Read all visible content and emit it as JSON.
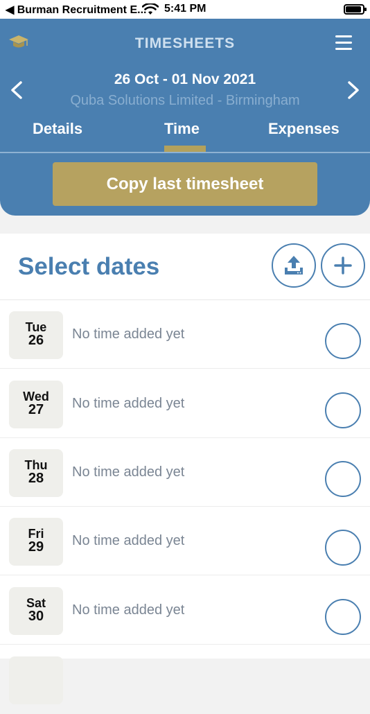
{
  "status_bar": {
    "back_label": "◀ Burman Recruitment E...",
    "time": "5:41 PM"
  },
  "header": {
    "title": "TIMESHEETS",
    "date_range": "26 Oct - 01 Nov 2021",
    "company": "Quba Solutions Limited - Birmingham",
    "tabs": [
      {
        "label": "Details"
      },
      {
        "label": "Time"
      },
      {
        "label": "Expenses"
      }
    ],
    "active_tab": "Time",
    "copy_button": "Copy last timesheet"
  },
  "select_dates": {
    "title": "Select dates",
    "days": [
      {
        "name": "Tue",
        "num": "26",
        "status": "No time added yet"
      },
      {
        "name": "Wed",
        "num": "27",
        "status": "No time added yet"
      },
      {
        "name": "Thu",
        "num": "28",
        "status": "No time added yet"
      },
      {
        "name": "Fri",
        "num": "29",
        "status": "No time added yet"
      },
      {
        "name": "Sat",
        "num": "30",
        "status": "No time added yet"
      }
    ]
  },
  "colors": {
    "primary": "#4a7fb0",
    "accent": "#b6a260"
  },
  "icons": [
    "back-arrow-icon",
    "wifi-icon",
    "battery-icon",
    "graduation-cap-icon",
    "hamburger-menu-icon",
    "chevron-left-icon",
    "chevron-right-icon",
    "upload-icon",
    "plus-icon"
  ]
}
